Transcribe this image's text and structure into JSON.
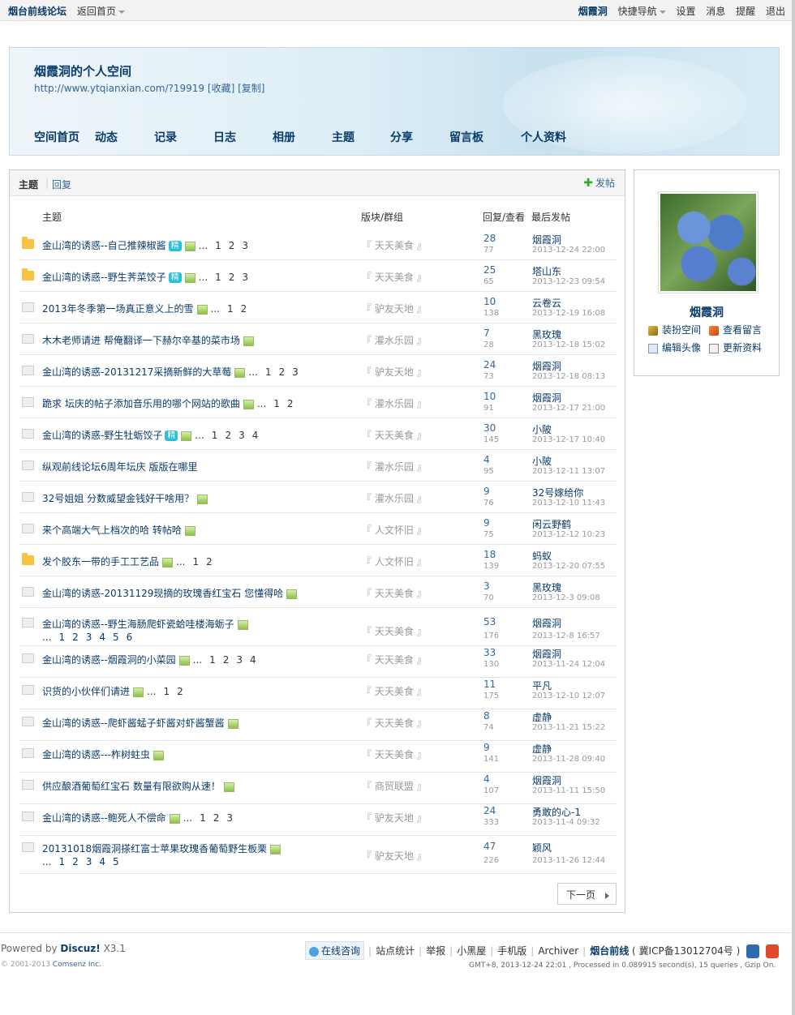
{
  "topbar": {
    "forum_name": "烟台前线论坛",
    "back_home": "返回首页",
    "username": "烟霞洞",
    "quick_nav": "快捷导航",
    "settings": "设置",
    "messages": "消息",
    "reminders": "提醒",
    "logout": "退出"
  },
  "header": {
    "title": "烟霞洞的个人空间",
    "url": "http://www.ytqianxian.com/?19919",
    "favorite": "[收藏]",
    "copy": "[复制]",
    "nav": [
      "空间首页",
      "动态",
      "记录",
      "日志",
      "相册",
      "主题",
      "分享",
      "留言板",
      "个人资料"
    ]
  },
  "tabs": {
    "topics": "主题",
    "replies": "回复",
    "post": "发帖"
  },
  "table": {
    "headers": {
      "subject": "主题",
      "forum": "版块/群组",
      "reply_view": "回复/查看",
      "last_post": "最后发帖"
    },
    "rows": [
      {
        "icon": "folder",
        "subject": "金山湾的诱惑--自己推辣椒酱",
        "jing": "精",
        "pic": true,
        "pages": [
          "...",
          "1",
          "2",
          "3"
        ],
        "pages2": [],
        "forum": "『 天天美食 』",
        "replies": "28",
        "views": "77",
        "user": "烟霞洞",
        "date": "2013-12-24 22:00"
      },
      {
        "icon": "folder",
        "subject": "金山湾的诱惑--野生荠菜饺子",
        "jing": "精",
        "pic": true,
        "pages": [
          "...",
          "1",
          "2",
          "3"
        ],
        "pages2": [],
        "forum": "『 天天美食 』",
        "replies": "25",
        "views": "65",
        "user": "塔山东",
        "date": "2013-12-23 09:54"
      },
      {
        "icon": "doc",
        "subject": "2013年冬季第一场真正意义上的雪",
        "jing": "",
        "pic": true,
        "pages": [
          "...",
          "1",
          "2"
        ],
        "pages2": [],
        "forum": "『 驴友天地 』",
        "replies": "10",
        "views": "138",
        "user": "云卷云",
        "date": "2013-12-19 16:08"
      },
      {
        "icon": "doc",
        "subject": "木木老师请进 帮俺翻译一下赫尔辛基的菜市场",
        "jing": "",
        "pic": true,
        "pages": [],
        "pages2": [],
        "forum": "『 灌水乐园 』",
        "replies": "7",
        "views": "28",
        "user": "黑玫瑰",
        "date": "2013-12-18 15:02"
      },
      {
        "icon": "doc",
        "subject": "金山湾的诱惑-20131217采摘新鲜的大草莓",
        "jing": "",
        "pic": true,
        "pages": [
          "...",
          "1",
          "2",
          "3"
        ],
        "pages2": [],
        "forum": "『 驴友天地 』",
        "replies": "24",
        "views": "73",
        "user": "烟霞洞",
        "date": "2013-12-18 08:13"
      },
      {
        "icon": "doc",
        "subject": "跪求 坛庆的帖子添加音乐用的哪个网站的歌曲",
        "jing": "",
        "pic": true,
        "pages": [
          "...",
          "1",
          "2"
        ],
        "pages2": [],
        "forum": "『 灌水乐园 』",
        "replies": "10",
        "views": "91",
        "user": "烟霞洞",
        "date": "2013-12-17 21:00"
      },
      {
        "icon": "doc",
        "subject": "金山湾的诱惑-野生牡蛎饺子",
        "jing": "精",
        "pic": true,
        "pages": [
          "...",
          "1",
          "2",
          "3",
          "4"
        ],
        "pages2": [],
        "forum": "『 天天美食 』",
        "replies": "30",
        "views": "145",
        "user": "小陂",
        "date": "2013-12-17 10:40"
      },
      {
        "icon": "doc",
        "subject": "纵观前线论坛6周年坛庆 版版在哪里",
        "jing": "",
        "pic": false,
        "pages": [],
        "pages2": [],
        "forum": "『 灌水乐园 』",
        "replies": "4",
        "views": "95",
        "user": "小陂",
        "date": "2013-12-11 13:07"
      },
      {
        "icon": "doc",
        "subject": "32号姐姐 分数威望金钱好干啥用？",
        "jing": "",
        "pic": true,
        "pages": [],
        "pages2": [],
        "forum": "『 灌水乐园 』",
        "replies": "9",
        "views": "76",
        "user": "32号嫁给你",
        "date": "2013-12-10 11:43"
      },
      {
        "icon": "doc",
        "subject": "来个高端大气上档次的哈 转帖哈",
        "jing": "",
        "pic": true,
        "pages": [],
        "pages2": [],
        "forum": "『 人文怀旧 』",
        "replies": "9",
        "views": "75",
        "user": "闲云野鹤",
        "date": "2013-12-12 10:23"
      },
      {
        "icon": "folder",
        "subject": "发个胶东一带的手工工艺品",
        "jing": "",
        "pic": true,
        "pages": [
          "...",
          "1",
          "2"
        ],
        "pages2": [],
        "forum": "『 人文怀旧 』",
        "replies": "18",
        "views": "139",
        "user": "蚂蚁",
        "date": "2013-12-20 07:55"
      },
      {
        "icon": "doc",
        "subject": "金山湾的诱惑-20131129现摘的玫瑰香红宝石 您懂得哈",
        "jing": "",
        "pic": true,
        "pages": [],
        "pages2": [],
        "forum": "『 天天美食 』",
        "replies": "3",
        "views": "70",
        "user": "黑玫瑰",
        "date": "2013-12-3 09:08"
      },
      {
        "icon": "doc",
        "subject": "金山湾的诱惑--野生海肠爬虾瓷蛤哇楼海蛎子",
        "jing": "",
        "pic": true,
        "pages": [],
        "pages2": [
          "...",
          "1",
          "2",
          "3",
          "4",
          "5",
          "6"
        ],
        "forum": "『 天天美食 』",
        "replies": "53",
        "views": "176",
        "user": "烟霞洞",
        "date": "2013-12-8 16:57"
      },
      {
        "icon": "doc",
        "subject": "金山湾的诱惑--烟霞洞的小菜园",
        "jing": "",
        "pic": true,
        "pages": [
          "...",
          "1",
          "2",
          "3",
          "4"
        ],
        "pages2": [],
        "forum": "『 天天美食 』",
        "replies": "33",
        "views": "130",
        "user": "烟霞洞",
        "date": "2013-11-24 12:04"
      },
      {
        "icon": "doc",
        "subject": "识货的小伙伴们请进",
        "jing": "",
        "pic": true,
        "pages": [
          "...",
          "1",
          "2"
        ],
        "pages2": [],
        "forum": "『 天天美食 』",
        "replies": "11",
        "views": "175",
        "user": "平凡",
        "date": "2013-12-10 12:07"
      },
      {
        "icon": "doc",
        "subject": "金山湾的诱惑--爬虾酱蜢子虾酱对虾酱蟹酱",
        "jing": "",
        "pic": true,
        "pages": [],
        "pages2": [],
        "forum": "『 天天美食 』",
        "replies": "8",
        "views": "74",
        "user": "虚静",
        "date": "2013-11-21 15:22"
      },
      {
        "icon": "doc",
        "subject": "金山湾的诱惑---柞树蛀虫",
        "jing": "",
        "pic": true,
        "pages": [],
        "pages2": [],
        "forum": "『 天天美食 』",
        "replies": "9",
        "views": "141",
        "user": "虚静",
        "date": "2013-11-28 09:40"
      },
      {
        "icon": "doc",
        "subject": "供应酿酒葡萄红宝石 数量有限欲购从速！",
        "jing": "",
        "pic": true,
        "pages": [],
        "pages2": [],
        "forum": "『 商贸联盟 』",
        "replies": "4",
        "views": "107",
        "user": "烟霞洞",
        "date": "2013-11-11 15:50"
      },
      {
        "icon": "doc",
        "subject": "金山湾的诱惑--鲍死人不偿命",
        "jing": "",
        "pic": true,
        "pages": [
          "...",
          "1",
          "2",
          "3"
        ],
        "pages2": [],
        "forum": "『 驴友天地 』",
        "replies": "24",
        "views": "333",
        "user": "勇敢的心-1",
        "date": "2013-11-4 09:32"
      },
      {
        "icon": "doc",
        "subject": "20131018烟霞洞搽红富士苹果玫瑰香葡萄野生板栗",
        "jing": "",
        "pic": true,
        "pages": [],
        "pages2": [
          "...",
          "1",
          "2",
          "3",
          "4",
          "5"
        ],
        "forum": "『 驴友天地 』",
        "replies": "47",
        "views": "226",
        "user": "颖风",
        "date": "2013-11-26 12:44"
      }
    ]
  },
  "pager": {
    "next": "下一页"
  },
  "side": {
    "username": "烟霞洞",
    "decorate": "装扮空间",
    "view_msg": "查看留言",
    "edit_avatar": "编辑头像",
    "update_profile": "更新资料"
  },
  "footer": {
    "powered_by": "Powered by",
    "product": "Discuz!",
    "version": "X3.1",
    "copyright": "© 2001-2013",
    "company": "Comsenz Inc.",
    "chat": "在线咨询",
    "links": [
      "站点统计",
      "举报",
      "小黑屋",
      "手机版",
      "Archiver"
    ],
    "site": "烟台前线",
    "icp": "( 冀ICP备13012704号 )",
    "stats": "GMT+8, 2013-12-24 22:01 , Processed in 0.089915 second(s), 15 queries , Gzip On."
  }
}
